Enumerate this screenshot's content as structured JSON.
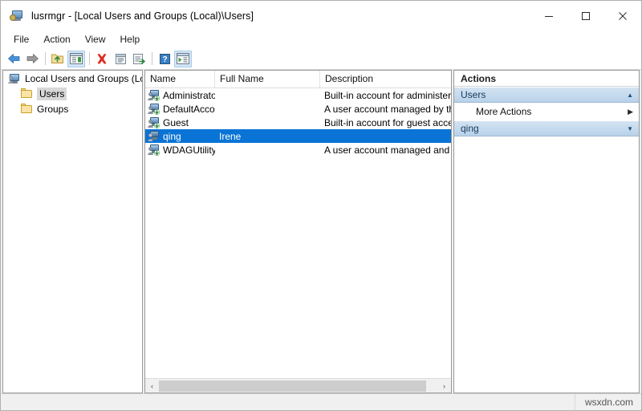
{
  "window": {
    "title": "lusrmgr - [Local Users and Groups (Local)\\Users]",
    "icon": "computer-management-icon",
    "minimize_label": "—",
    "maximize_label": "□",
    "close_label": "✕"
  },
  "menubar": {
    "items": [
      {
        "label": "File"
      },
      {
        "label": "Action"
      },
      {
        "label": "View"
      },
      {
        "label": "Help"
      }
    ]
  },
  "toolbar": {
    "buttons": [
      {
        "name": "back-icon",
        "tooltip": "Back"
      },
      {
        "name": "forward-icon",
        "tooltip": "Forward"
      },
      {
        "name": "up-one-level-icon",
        "tooltip": "Up One Level"
      },
      {
        "name": "show-hide-console-tree-icon",
        "tooltip": "Show/Hide Console Tree"
      },
      {
        "name": "delete-icon",
        "tooltip": "Delete"
      },
      {
        "name": "properties-icon",
        "tooltip": "Properties"
      },
      {
        "name": "export-list-icon",
        "tooltip": "Export List"
      },
      {
        "name": "help-icon",
        "tooltip": "Help"
      },
      {
        "name": "show-hide-action-pane-icon",
        "tooltip": "Show/Hide Action Pane"
      }
    ]
  },
  "tree": {
    "nodes": [
      {
        "label": "Local Users and Groups (Local)",
        "icon": "computer-icon",
        "selected": false,
        "indent": false
      },
      {
        "label": "Users",
        "icon": "folder-icon",
        "selected": true,
        "indent": true
      },
      {
        "label": "Groups",
        "icon": "folder-icon",
        "selected": false,
        "indent": true
      }
    ]
  },
  "list": {
    "columns": [
      {
        "label": "Name"
      },
      {
        "label": "Full Name"
      },
      {
        "label": "Description"
      }
    ],
    "rows": [
      {
        "name": "Administrator",
        "full_name": "",
        "description": "Built-in account for administering",
        "selected": false,
        "disabled": true
      },
      {
        "name": "DefaultAcco...",
        "full_name": "",
        "description": "A user account managed by the s",
        "selected": false,
        "disabled": true
      },
      {
        "name": "Guest",
        "full_name": "",
        "description": "Built-in account for guest access",
        "selected": false,
        "disabled": true
      },
      {
        "name": "qing",
        "full_name": "Irene",
        "description": "",
        "selected": true,
        "disabled": false
      },
      {
        "name": "WDAGUtility...",
        "full_name": "",
        "description": "A user account managed and use",
        "selected": false,
        "disabled": true
      }
    ],
    "hscroll": {
      "left_arrow": "‹",
      "right_arrow": "›"
    }
  },
  "actions": {
    "title": "Actions",
    "groups": [
      {
        "label": "Users",
        "chevron": "▲",
        "expanded": true,
        "items": [
          {
            "label": "More Actions",
            "submenu_arrow": "▶"
          }
        ]
      },
      {
        "label": "qing",
        "chevron": "▼",
        "expanded": false,
        "items": []
      }
    ]
  },
  "statusbar": {
    "watermark": "wsxdn.com"
  },
  "colors": {
    "selection_blue": "#0a74d6",
    "action_header_blue": "#bdd5ec",
    "window_bg": "#ffffff"
  }
}
